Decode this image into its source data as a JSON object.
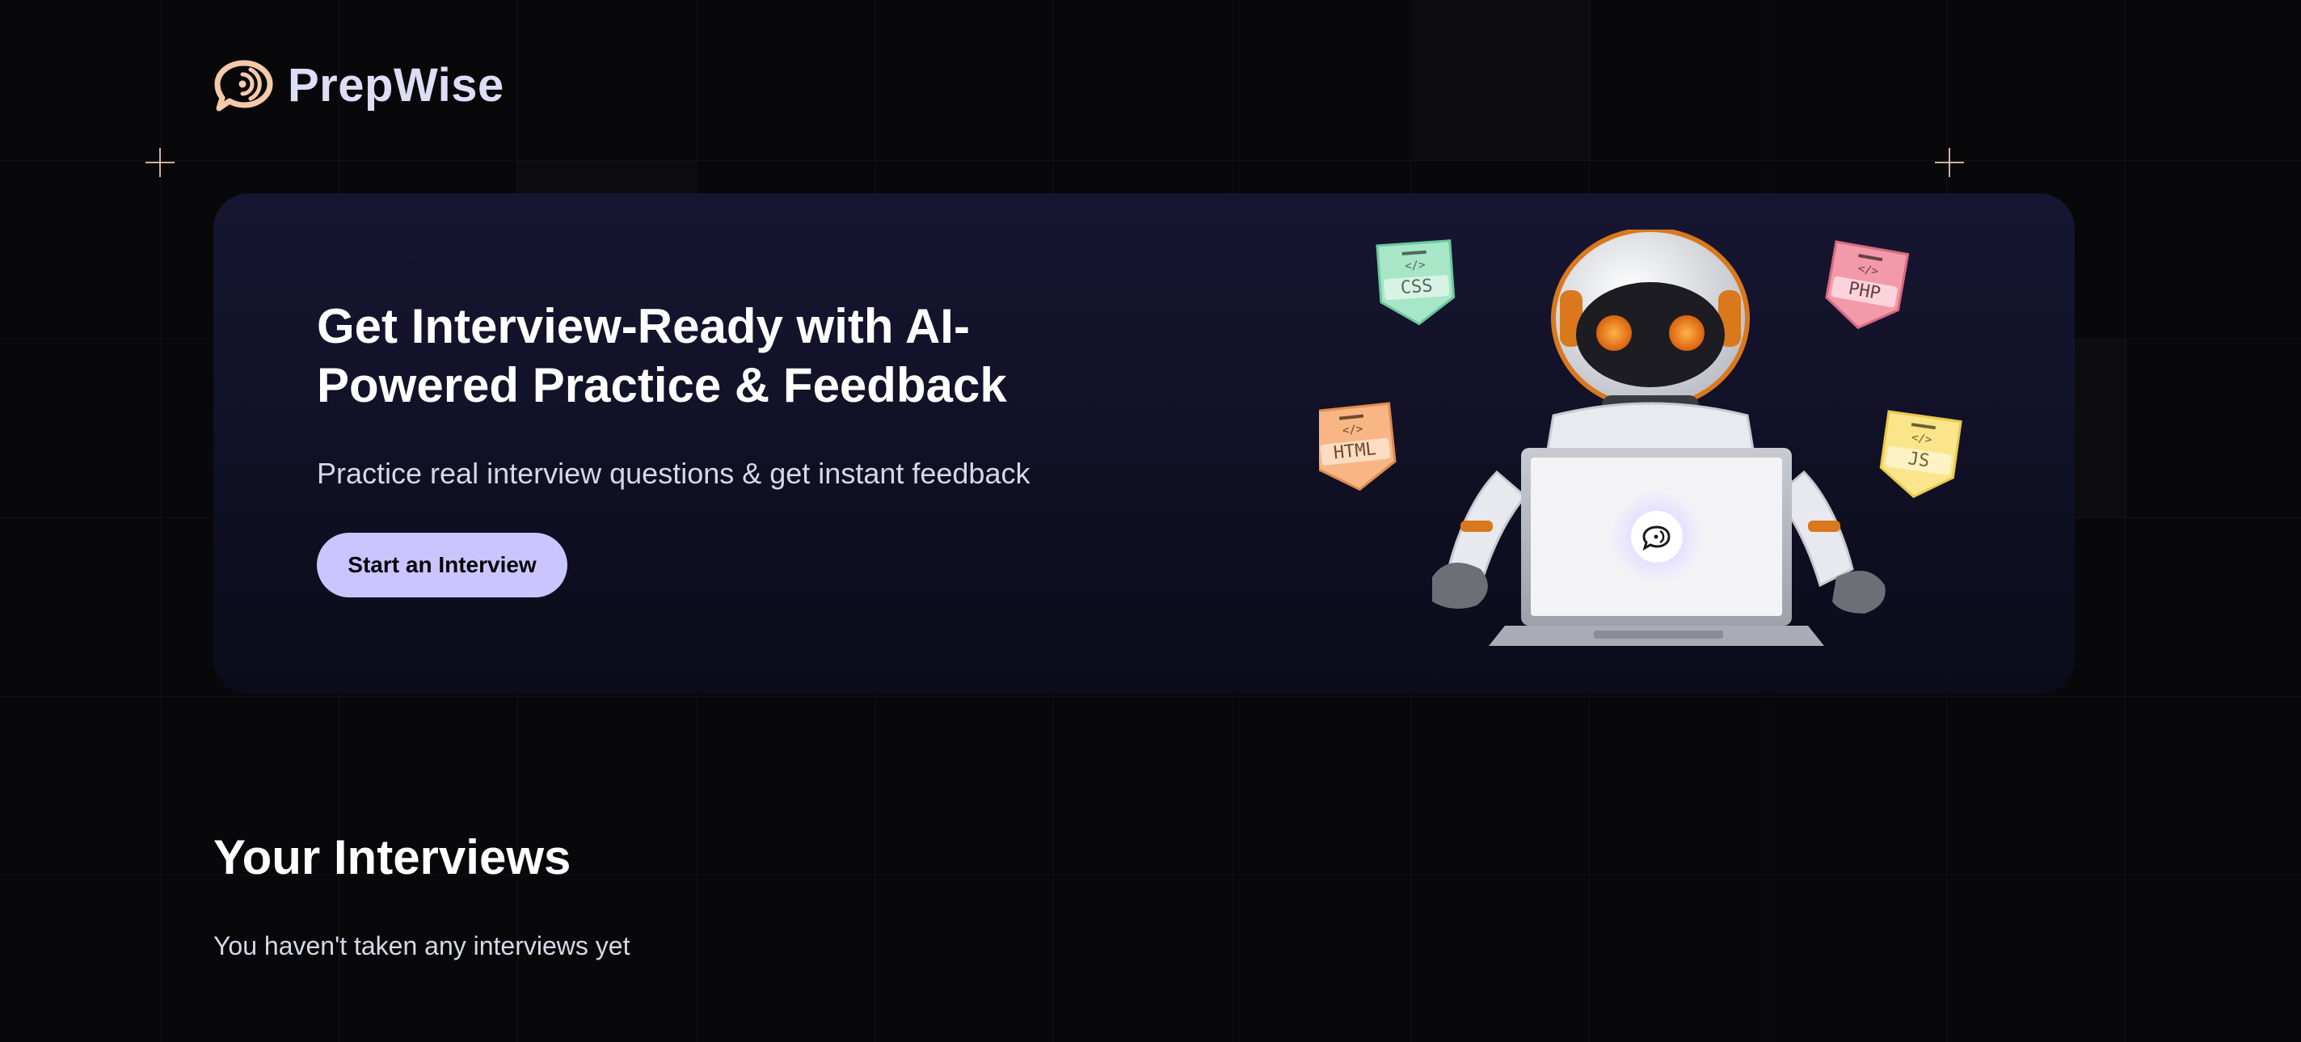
{
  "brand": {
    "name": "PrepWise",
    "accent": "#cac5fe",
    "logo_color": "#f5c9a9"
  },
  "hero": {
    "title": "Get Interview-Ready with AI-Powered Practice & Feedback",
    "subtitle": "Practice real interview questions & get instant feedback",
    "cta_label": "Start an Interview",
    "tags": [
      "CSS",
      "PHP",
      "HTML",
      "JS"
    ]
  },
  "interviews": {
    "heading": "Your Interviews",
    "empty_message": "You haven't taken any interviews yet"
  }
}
